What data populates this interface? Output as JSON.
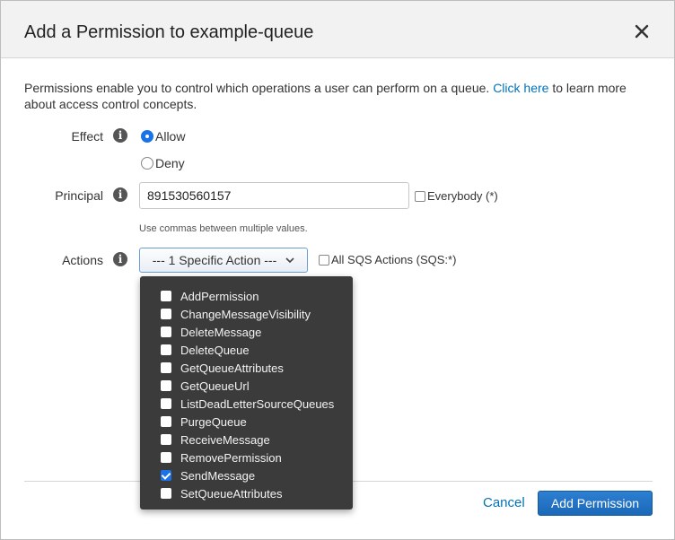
{
  "dialog": {
    "title": "Add a Permission to example-queue"
  },
  "intro": {
    "text": "Permissions enable you to control which operations a user can perform on a queue.",
    "link": "Click here",
    "text_after": "to learn more about access control concepts."
  },
  "effect": {
    "label": "Effect",
    "options": [
      {
        "label": "Allow",
        "selected": true
      },
      {
        "label": "Deny",
        "selected": false
      }
    ]
  },
  "principal": {
    "label": "Principal",
    "value": "891530560157",
    "everybody_label": "Everybody (*)",
    "hint": "Use commas between multiple values."
  },
  "actions": {
    "label": "Actions",
    "select_label": "--- 1 Specific Action ---",
    "all_label": "All SQS Actions (SQS:*)",
    "items": [
      {
        "label": "AddPermission",
        "checked": false
      },
      {
        "label": "ChangeMessageVisibility",
        "checked": false
      },
      {
        "label": "DeleteMessage",
        "checked": false
      },
      {
        "label": "DeleteQueue",
        "checked": false
      },
      {
        "label": "GetQueueAttributes",
        "checked": false
      },
      {
        "label": "GetQueueUrl",
        "checked": false
      },
      {
        "label": "ListDeadLetterSourceQueues",
        "checked": false
      },
      {
        "label": "PurgeQueue",
        "checked": false
      },
      {
        "label": "ReceiveMessage",
        "checked": false
      },
      {
        "label": "RemovePermission",
        "checked": false
      },
      {
        "label": "SendMessage",
        "checked": true
      },
      {
        "label": "SetQueueAttributes",
        "checked": false
      }
    ]
  },
  "footer": {
    "cancel_label": "Cancel",
    "submit_label": "Add Permission"
  },
  "colors": {
    "accent": "#1a73e8",
    "link": "#0073bb",
    "menu_bg": "#3b3b3b"
  }
}
